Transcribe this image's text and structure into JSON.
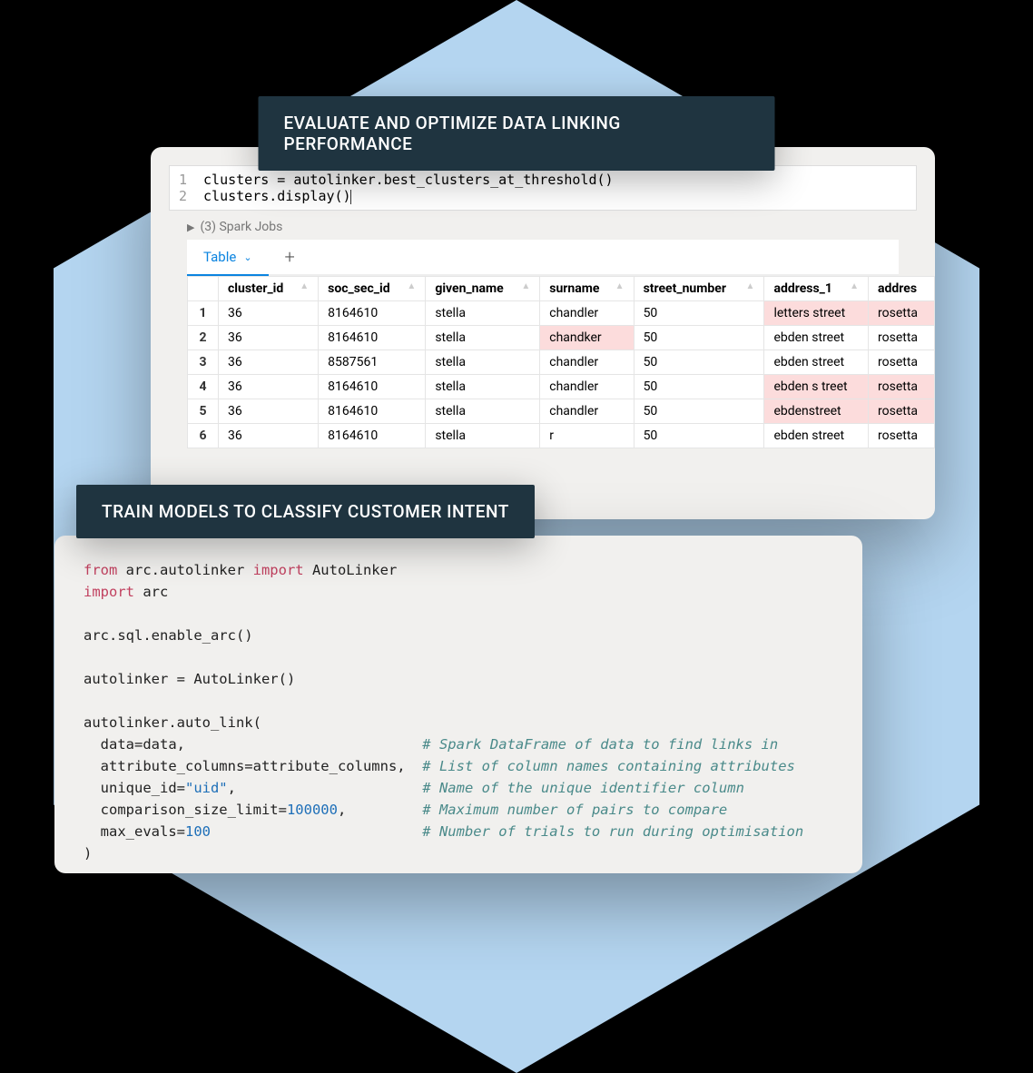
{
  "banners": {
    "top": "EVALUATE AND OPTIMIZE DATA LINKING PERFORMANCE",
    "mid": "TRAIN MODELS TO CLASSIFY CUSTOMER INTENT"
  },
  "cell": {
    "line1_no": "1",
    "line2_no": "2",
    "line1": "clusters = autolinker.best_clusters_at_threshold()",
    "line2": "clusters.display()"
  },
  "jobs": {
    "label": "(3) Spark Jobs"
  },
  "tabs": {
    "active": "Table",
    "add": "+"
  },
  "table": {
    "headers": {
      "cluster_id": "cluster_id",
      "soc_sec_id": "soc_sec_id",
      "given_name": "given_name",
      "surname": "surname",
      "street_number": "street_number",
      "address_1": "address_1",
      "address_2": "addres"
    },
    "rows": [
      {
        "n": "1",
        "cluster_id": "36",
        "soc_sec_id": "8164610",
        "given_name": "stella",
        "surname": "chandler",
        "surname_hl": false,
        "street_number": "50",
        "address_1": "letters street",
        "address_1_hl": true,
        "address_2": "rosetta",
        "address_2_hl": true
      },
      {
        "n": "2",
        "cluster_id": "36",
        "soc_sec_id": "8164610",
        "given_name": "stella",
        "surname": "chandker",
        "surname_hl": true,
        "street_number": "50",
        "address_1": "ebden street",
        "address_1_hl": false,
        "address_2": "rosetta",
        "address_2_hl": false
      },
      {
        "n": "3",
        "cluster_id": "36",
        "soc_sec_id": "8587561",
        "given_name": "stella",
        "surname": "chandler",
        "surname_hl": false,
        "street_number": "50",
        "address_1": "ebden street",
        "address_1_hl": false,
        "address_2": "rosetta",
        "address_2_hl": false
      },
      {
        "n": "4",
        "cluster_id": "36",
        "soc_sec_id": "8164610",
        "given_name": "stella",
        "surname": "chandler",
        "surname_hl": false,
        "street_number": "50",
        "address_1": "ebden s treet",
        "address_1_hl": true,
        "address_2": "rosetta",
        "address_2_hl": true
      },
      {
        "n": "5",
        "cluster_id": "36",
        "soc_sec_id": "8164610",
        "given_name": "stella",
        "surname": "chandler",
        "surname_hl": false,
        "street_number": "50",
        "address_1": "ebdenstreet",
        "address_1_hl": true,
        "address_2": "rosetta",
        "address_2_hl": true
      },
      {
        "n": "6",
        "cluster_id": "36",
        "soc_sec_id": "8164610",
        "given_name": "stella",
        "surname": "r",
        "surname_hl": false,
        "street_number": "50",
        "address_1": "ebden street",
        "address_1_hl": false,
        "address_2": "rosetta",
        "address_2_hl": false
      }
    ]
  },
  "code": {
    "kw_from": "from",
    "mod1": " arc.autolinker ",
    "kw_import": "import",
    "cls": " AutoLinker",
    "mod2": " arc",
    "l_enable": "arc.sql.enable_arc()",
    "l_inst": "autolinker = AutoLinker()",
    "l_call": "autolinker.auto_link(",
    "arg1": "  data=data,",
    "c1": "# Spark DataFrame of data to find links in",
    "arg2": "  attribute_columns=attribute_columns,",
    "c2": "# List of column names containing attributes",
    "arg3a": "  unique_id=",
    "arg3s": "\"uid\"",
    "arg3b": ",",
    "c3": "# Name of the unique identifier column",
    "arg4a": "  comparison_size_limit=",
    "arg4n": "100000",
    "arg4b": ",",
    "c4": "# Maximum number of pairs to compare",
    "arg5a": "  max_evals=",
    "arg5n": "100",
    "c5": "# Number of trials to run during optimisation",
    "close": ")"
  }
}
